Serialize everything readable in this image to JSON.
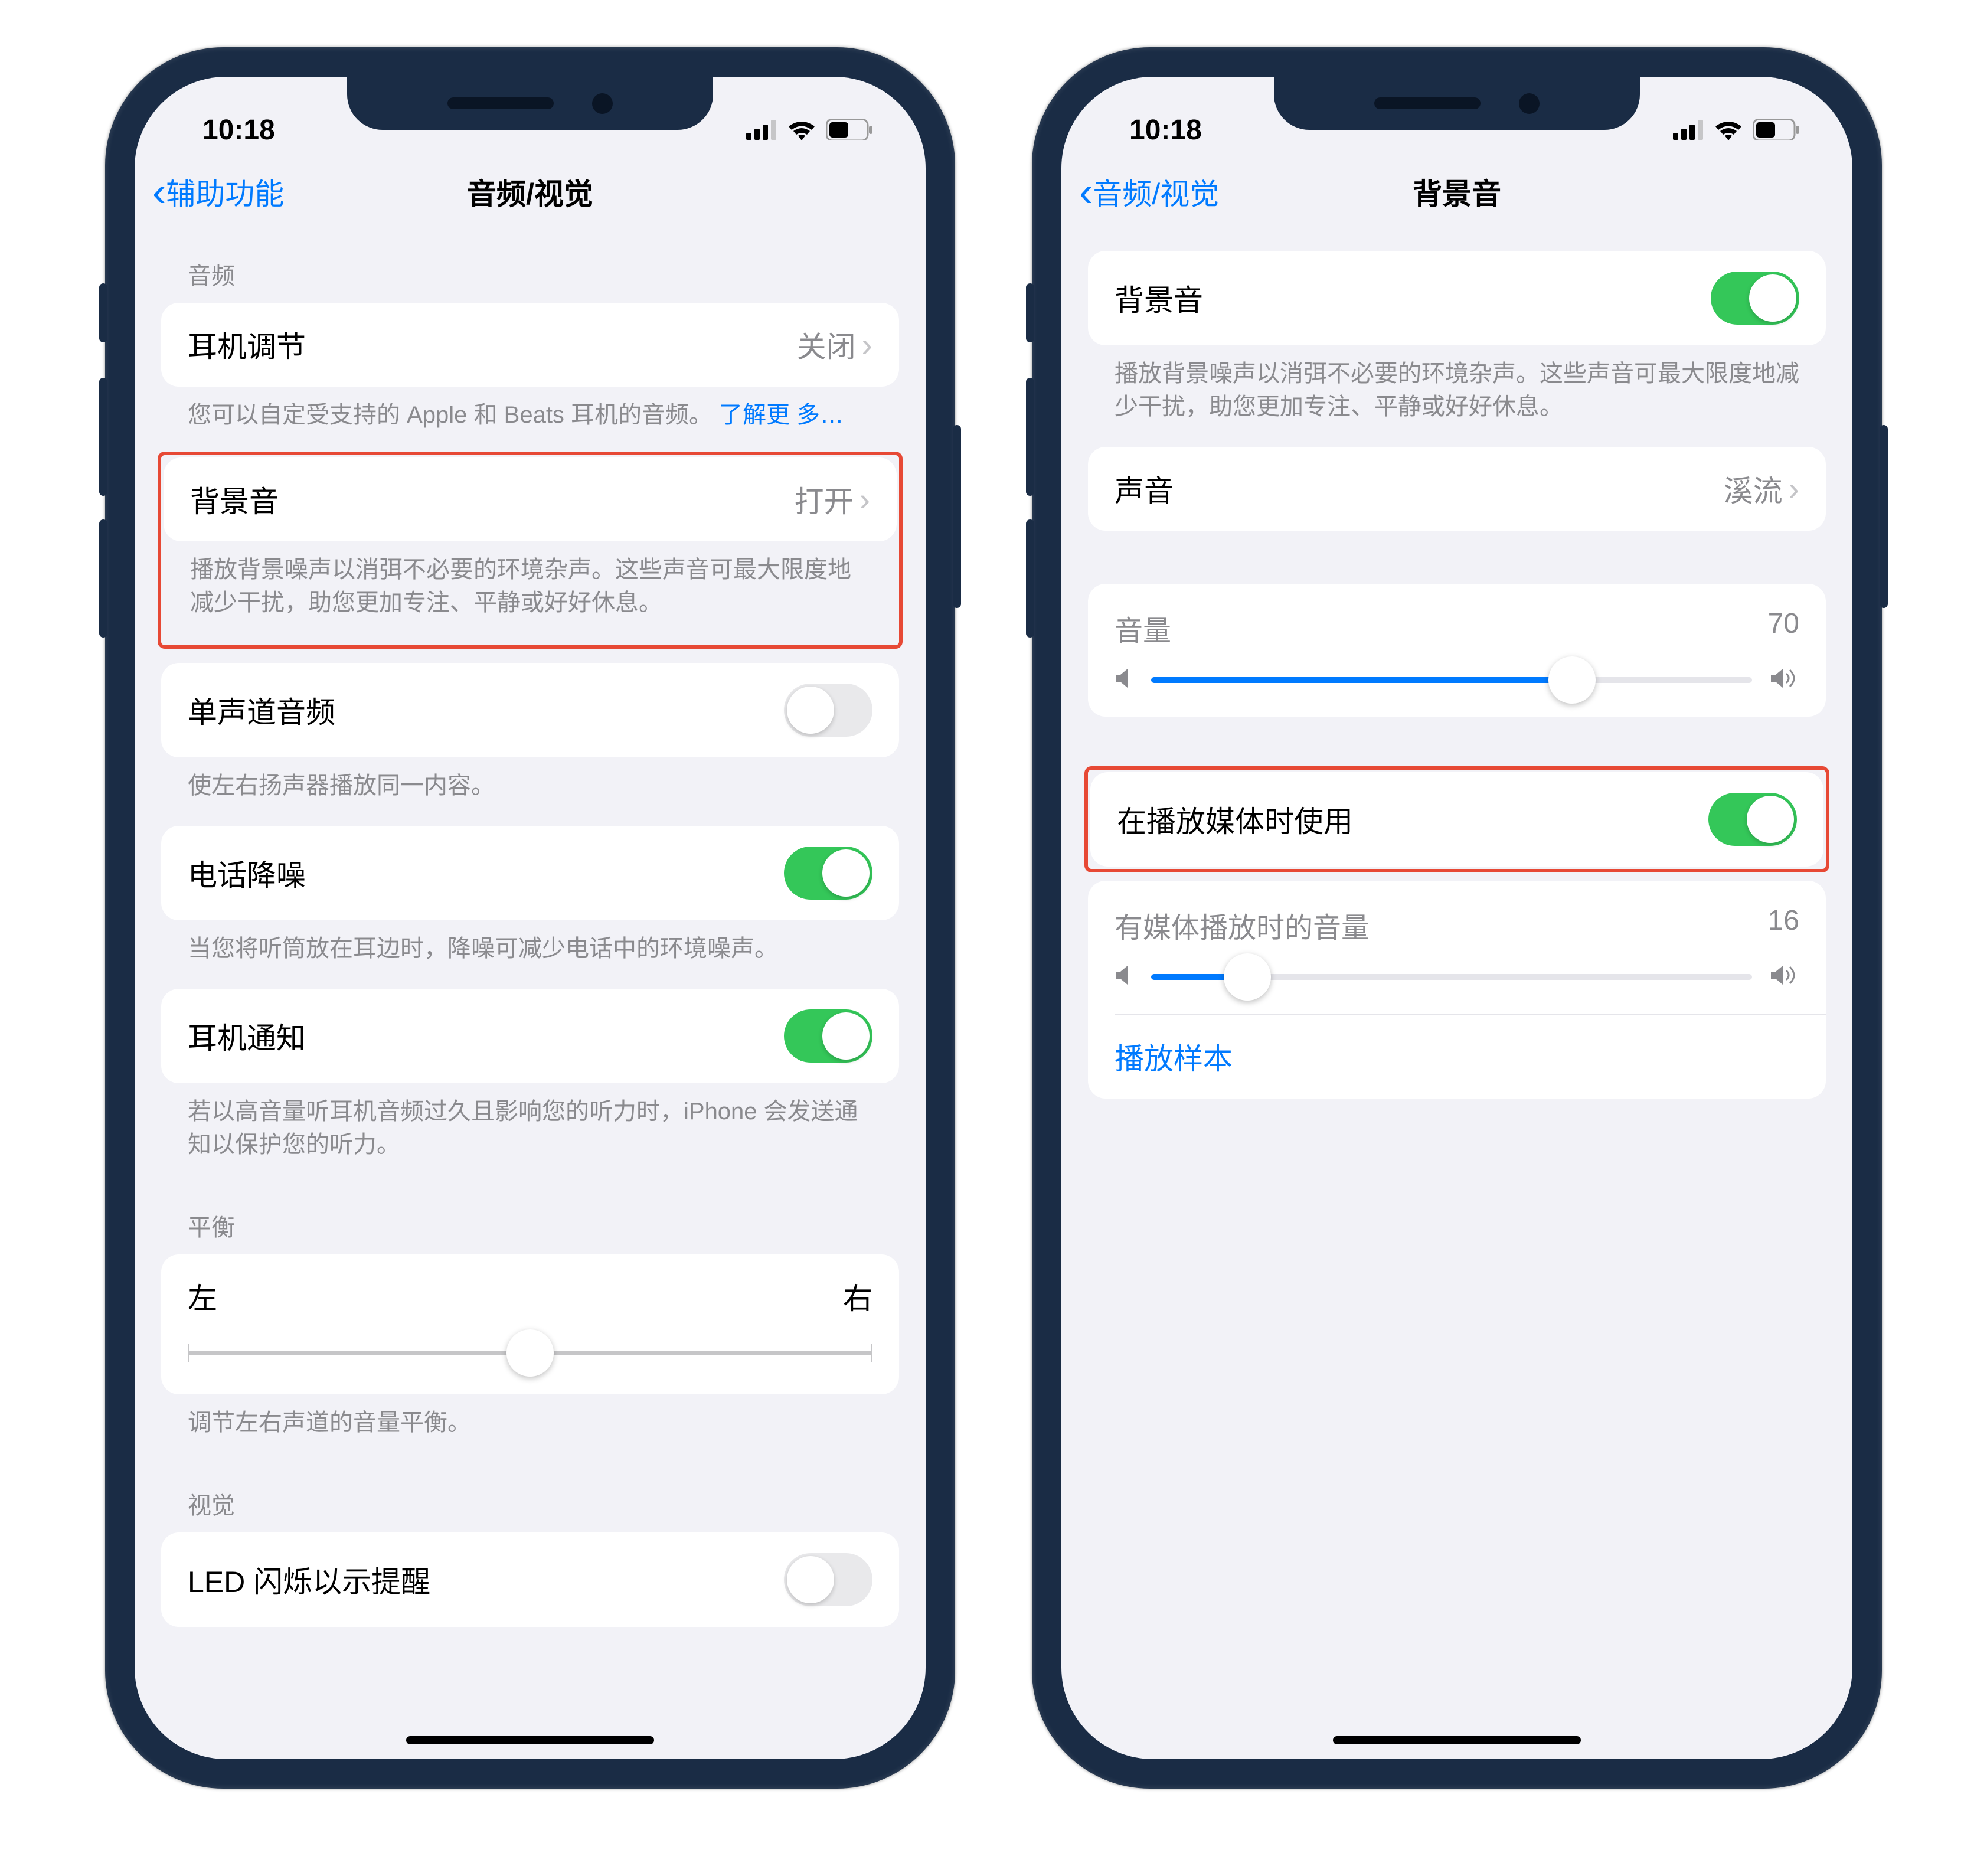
{
  "status": {
    "time": "10:18"
  },
  "phoneLeft": {
    "nav": {
      "back": "辅助功能",
      "title": "音频/视觉"
    },
    "section1": {
      "header": "音频",
      "headphone_accommodation": {
        "label": "耳机调节",
        "value": "关闭"
      },
      "footer_prefix": "您可以自定受支持的 Apple 和 Beats 耳机的音频。",
      "footer_link": "了解更 多…"
    },
    "section2": {
      "background_sounds": {
        "label": "背景音",
        "value": "打开"
      },
      "footer": "播放背景噪声以消弭不必要的环境杂声。这些声音可最大限度地减少干扰，助您更加专注、平静或好好休息。"
    },
    "section3": {
      "mono_audio": {
        "label": "单声道音频"
      },
      "mono_footer": "使左右扬声器播放同一内容。",
      "noise_cancel": {
        "label": "电话降噪"
      },
      "noise_footer": "当您将听筒放在耳边时，降噪可减少电话中的环境噪声。",
      "headphone_notify": {
        "label": "耳机通知"
      },
      "headphone_notify_footer": "若以高音量听耳机音频过久且影响您的听力时，iPhone 会发送通知以保护您的听力。"
    },
    "balance": {
      "header": "平衡",
      "left": "左",
      "right": "右",
      "footer": "调节左右声道的音量平衡。"
    },
    "visual": {
      "header": "视觉",
      "led_flash": {
        "label": "LED 闪烁以示提醒"
      }
    }
  },
  "phoneRight": {
    "nav": {
      "back": "音频/视觉",
      "title": "背景音"
    },
    "section1": {
      "bg_sounds": {
        "label": "背景音"
      },
      "footer": "播放背景噪声以消弭不必要的环境杂声。这些声音可最大限度地减少干扰，助您更加专注、平静或好好休息。"
    },
    "section2": {
      "sound": {
        "label": "声音",
        "value": "溪流"
      }
    },
    "section3": {
      "volume": {
        "label": "音量",
        "value": "70",
        "percent": 70
      }
    },
    "section4": {
      "use_with_media": {
        "label": "在播放媒体时使用"
      },
      "media_volume": {
        "label": "有媒体播放时的音量",
        "value": "16",
        "percent": 16
      },
      "play_sample": "播放样本"
    }
  }
}
